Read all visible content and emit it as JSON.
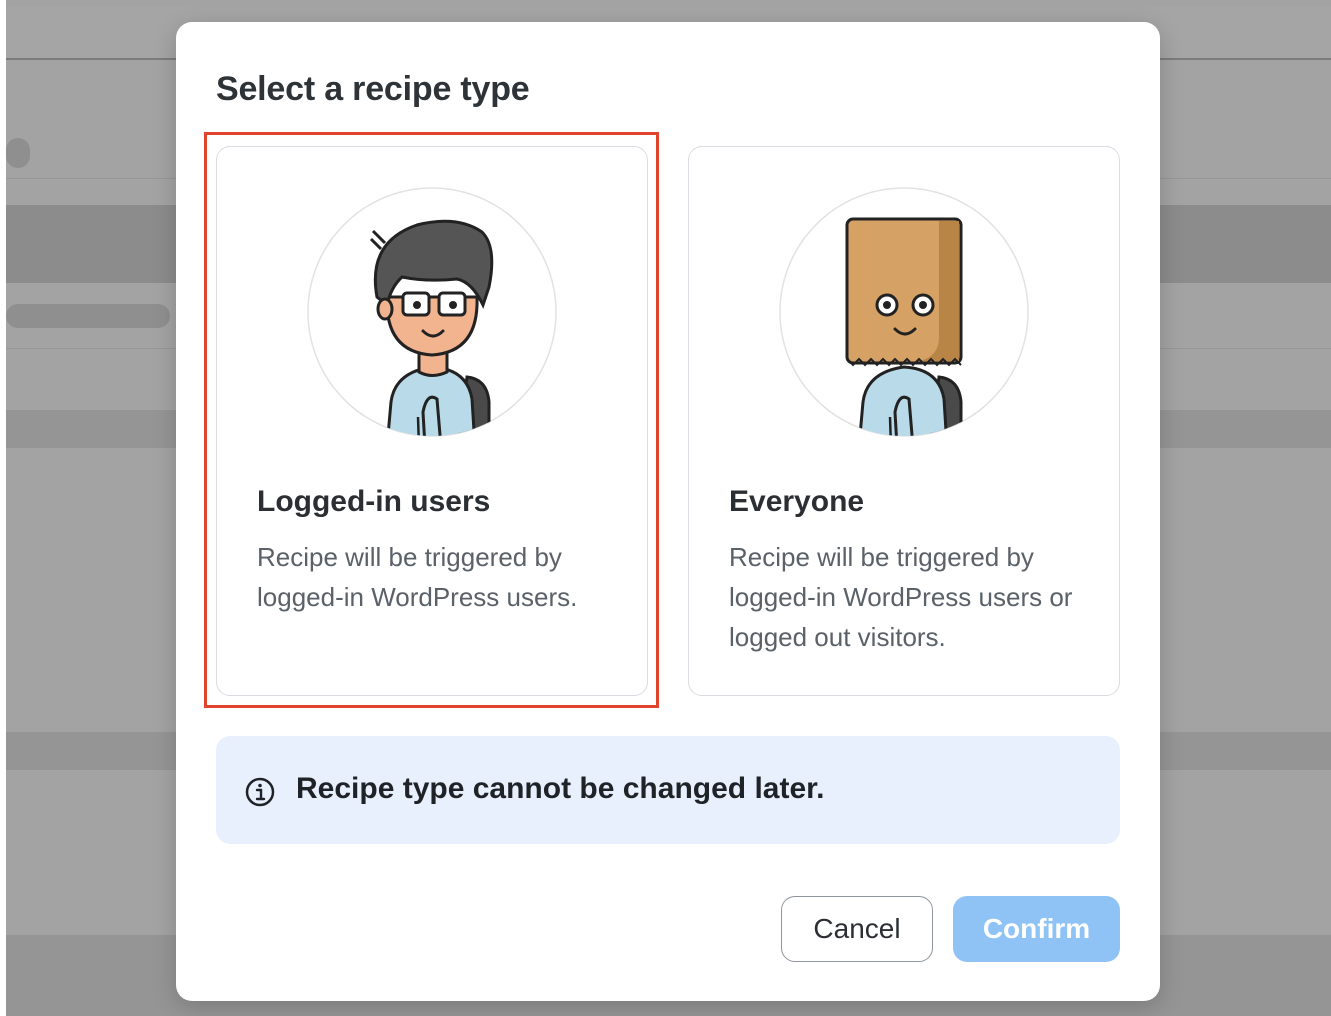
{
  "dialog": {
    "title": "Select a recipe type",
    "options": [
      {
        "title": "Logged-in users",
        "description": "Recipe will be triggered by logged-in WordPress users.",
        "avatar": "person-with-hair-illustration",
        "selected": true
      },
      {
        "title": "Everyone",
        "description": "Recipe will be triggered by logged-in WordPress users or logged out visitors.",
        "avatar": "person-with-paper-bag-illustration",
        "selected": false
      }
    ],
    "notice": {
      "icon": "info-icon",
      "text": "Recipe type cannot be changed later."
    },
    "buttons": {
      "cancel": "Cancel",
      "confirm": "Confirm"
    }
  },
  "colors": {
    "selection_outline": "#e0442e",
    "confirm_button": "#8fc3f6",
    "notice_background": "#e9f0fd",
    "overlay": "#a3a3a3"
  }
}
